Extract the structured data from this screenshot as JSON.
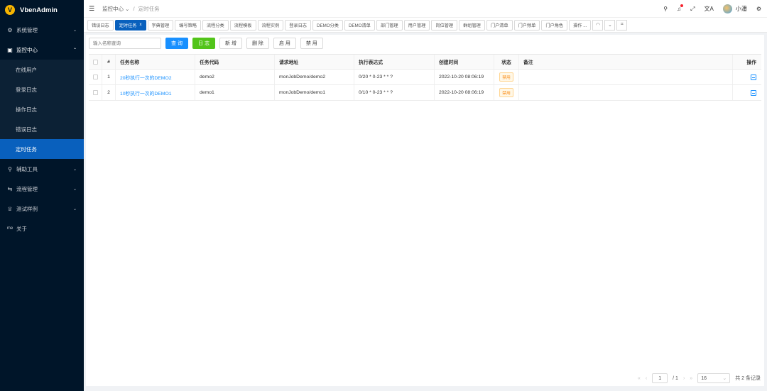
{
  "app": {
    "title": "VbenAdmin",
    "logo_letter": "V"
  },
  "sidebar": {
    "items": [
      {
        "label": "系统管理",
        "icon": "gear-icon",
        "glyph": "⚙",
        "arrow": "⌄"
      },
      {
        "label": "监控中心",
        "icon": "monitor-icon",
        "glyph": "▣",
        "arrow": "⌃"
      },
      {
        "label": "辅助工具",
        "icon": "wrench-icon",
        "glyph": "⚲",
        "arrow": "⌄"
      },
      {
        "label": "流程管理",
        "icon": "flow-icon",
        "glyph": "⇆",
        "arrow": "⌄"
      },
      {
        "label": "测试样例",
        "icon": "trophy-icon",
        "glyph": "♕",
        "arrow": "⌄"
      },
      {
        "label": "关于",
        "icon": "info-icon",
        "glyph": "me",
        "arrow": ""
      }
    ],
    "monitor_children": [
      {
        "label": "在线用户"
      },
      {
        "label": "登录日志"
      },
      {
        "label": "操作日志"
      },
      {
        "label": "错误日志"
      },
      {
        "label": "定时任务"
      }
    ]
  },
  "header": {
    "fold_glyph": "☰",
    "breadcrumb": {
      "parent": "监控中心",
      "parent_arrow": "⌄",
      "separator": "/",
      "current": "定时任务"
    },
    "icons": {
      "search": "⚲",
      "bell": "♫",
      "fullscreen": "⤢",
      "translate": "文A",
      "settings": "⚙"
    },
    "user_name": "小潘"
  },
  "tabs": {
    "items": [
      "错误日志",
      "定时任务",
      "字典管理",
      "编号策略",
      "流程分类",
      "流程模板",
      "流程实例",
      "登录日志",
      "DEMO分类",
      "DEMO清单",
      "部门管理",
      "用户管理",
      "岗位管理",
      "群组管理",
      "门户清单",
      "门户频单",
      "门户角色",
      "操作 ..."
    ],
    "close_glyph": "x",
    "controls": [
      "◠",
      "⌄",
      "⌗"
    ]
  },
  "toolbar": {
    "search_placeholder": "输入名称查询",
    "query_label": "查 询",
    "log_label": "日 志",
    "add_label": "新 增",
    "delete_label": "删 除",
    "enable_label": "启 用",
    "disable_label": "禁 用"
  },
  "table": {
    "headers": {
      "index": "#",
      "name": "任务名称",
      "code": "任务代码",
      "url": "请求地址",
      "cron": "执行表达式",
      "created": "创建时间",
      "status": "状态",
      "remark": "备注",
      "op": "操作"
    },
    "rows": [
      {
        "index": "1",
        "name": "20秒执行一次的DEMO2",
        "code": "demo2",
        "url": "monJobDemo/demo2",
        "cron": "0/20 * 0-23 * * ?",
        "created": "2022-10-20 08:06:19",
        "status": "禁用",
        "remark": ""
      },
      {
        "index": "2",
        "name": "10秒执行一次的DEMO1",
        "code": "demo1",
        "url": "monJobDemo/demo1",
        "cron": "0/10 * 0-23 * * ?",
        "created": "2022-10-20 08:06:19",
        "status": "禁用",
        "remark": ""
      }
    ]
  },
  "pager": {
    "first": "«",
    "prev": "‹",
    "page": "1",
    "total_pages": "/ 1",
    "next": "›",
    "last": "»",
    "page_size": "16",
    "size_arrow": "⌄",
    "total_text": "共 2 条记录"
  },
  "colors": {
    "sidebar_bg": "#001529",
    "active_blue": "#0960bd",
    "primary": "#1890ff",
    "success": "#52c41a",
    "warning": "#fa8c16"
  }
}
